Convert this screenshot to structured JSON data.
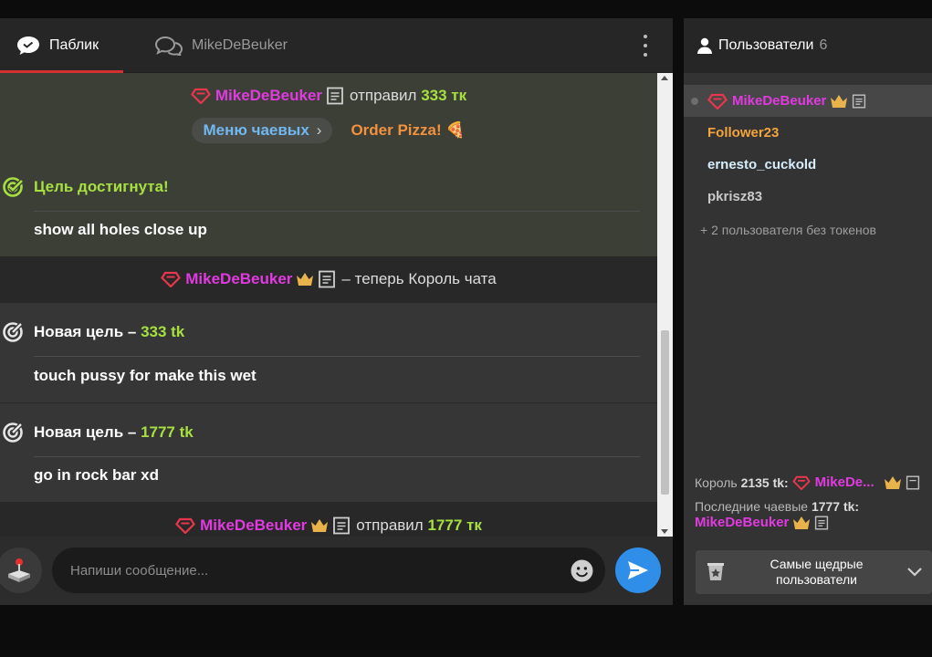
{
  "tabs": {
    "public": "Паблик",
    "private": "MikeDeBeuker"
  },
  "messages": {
    "tip1": {
      "nick": "MikeDeBeuker",
      "verb": "отправил",
      "amount": "333 тк"
    },
    "tip_menu": "Меню чаевых",
    "pizza": "Order Pizza! 🍕",
    "goal_reached": {
      "label": "Цель достигнута!",
      "text": "show all holes close up"
    },
    "king_msg": {
      "nick": "MikeDeBeuker",
      "text": "– теперь Король чата"
    },
    "goal2": {
      "prefix": "Новая цель –",
      "amount": "333 tk",
      "text": "touch pussy for make this wet"
    },
    "goal3": {
      "prefix": "Новая цель –",
      "amount": "1777 tk",
      "text": "go in rock bar xd"
    },
    "tip2": {
      "nick": "MikeDeBeuker",
      "verb": "отправил",
      "amount": "1777 тк"
    }
  },
  "composer": {
    "placeholder": "Напиши сообщение..."
  },
  "users": {
    "title": "Пользователи",
    "count": "6",
    "list": [
      "MikeDeBeuker",
      "Follower23",
      "ernesto_cuckold",
      "pkrisz83"
    ],
    "guests": "+ 2 пользователя без токенов",
    "king_label": "Король",
    "king_amount": "2135 tk:",
    "king_nick": "MikeDe...",
    "last_tip_label": "Последние чаевые",
    "last_tip_amount": "1777 tk:",
    "last_tip_nick": "MikeDeBeuker",
    "top_button": "Самые щедрые\nпользователи"
  },
  "colors": {
    "accent": "#d3302f",
    "nick": "#e03ae0",
    "tokens": "#a6e040",
    "send": "#2f8ee8",
    "crown": "#e8b34a"
  }
}
